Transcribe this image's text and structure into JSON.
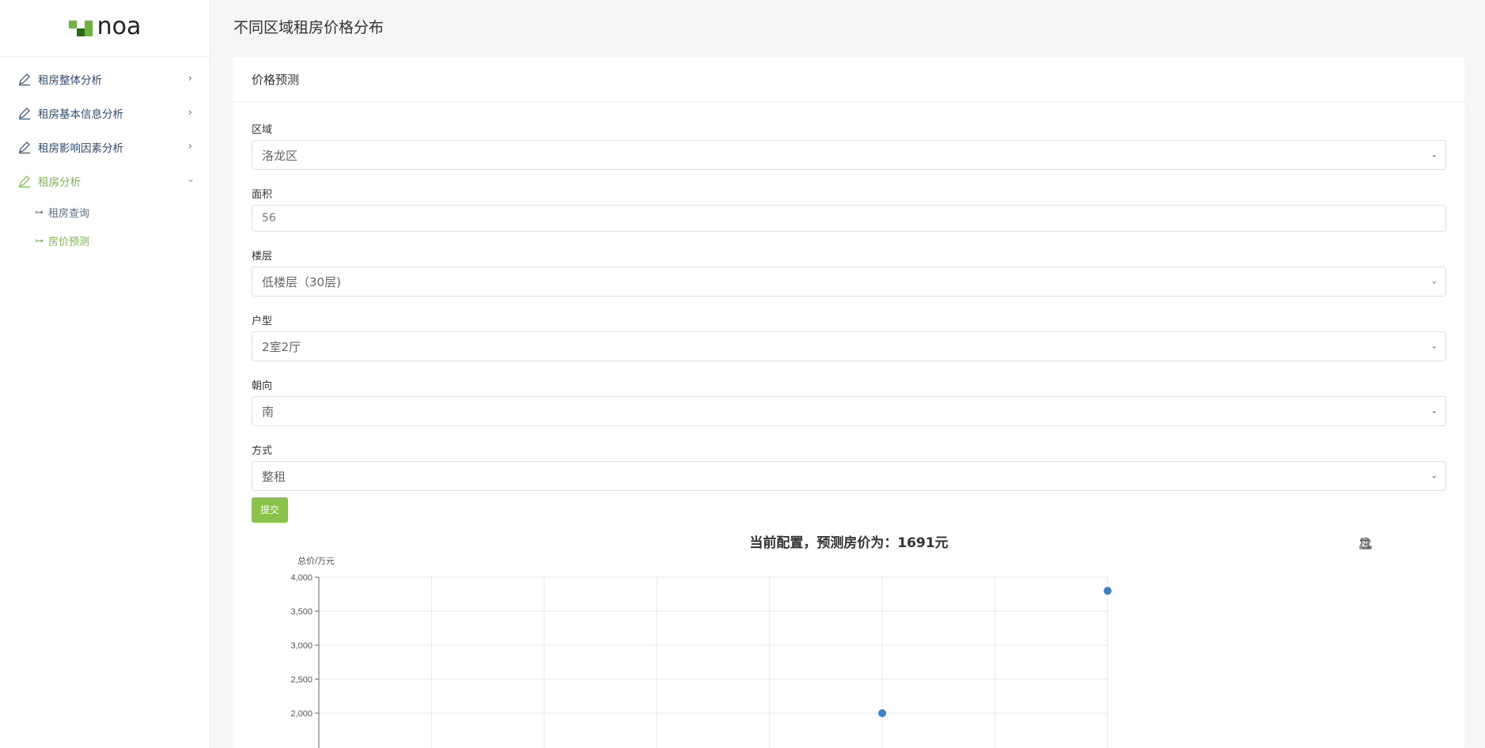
{
  "logo": {
    "text": "noa"
  },
  "sidebar": {
    "items": [
      {
        "label": "租房整体分析",
        "expanded": false
      },
      {
        "label": "租房基本信息分析",
        "expanded": false
      },
      {
        "label": "租房影响因素分析",
        "expanded": false
      },
      {
        "label": "租房分析",
        "expanded": true
      }
    ],
    "sub_items": [
      {
        "label": "租房查询",
        "active": false
      },
      {
        "label": "房价预测",
        "active": true
      }
    ],
    "accent_color": "#78b84c"
  },
  "page": {
    "title": "不同区域租房价格分布"
  },
  "card": {
    "title": "价格预测"
  },
  "form": {
    "region": {
      "label": "区域",
      "value": "洛龙区"
    },
    "area": {
      "label": "面积",
      "value": "56"
    },
    "floor": {
      "label": "楼层",
      "value": "低楼层（30层)"
    },
    "layout": {
      "label": "户型",
      "value": "2室2厅"
    },
    "orientation": {
      "label": "朝向",
      "value": "南"
    },
    "mode": {
      "label": "方式",
      "value": "整租"
    },
    "submit_label": "提交",
    "submit_color": "#8bc34a"
  },
  "chart_data": {
    "type": "scatter",
    "title": "当前配置，预测房价为：1691元",
    "ylabel": "总价/万元",
    "yticks": [
      "4,000",
      "3,500",
      "3,000",
      "2,500",
      "2,000"
    ],
    "ylim": [
      2000,
      4000
    ],
    "grid": true,
    "points": [
      {
        "x": 5,
        "y": 2000
      },
      {
        "x": 7,
        "y": 3800
      }
    ],
    "xlim": [
      0,
      7
    ],
    "color": "#3b7fcf",
    "toolbox": [
      "zoom-icon",
      "zoom-reset-icon",
      "restore-icon",
      "download-icon"
    ]
  }
}
